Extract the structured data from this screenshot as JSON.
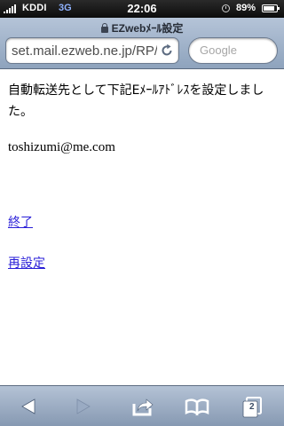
{
  "status_bar": {
    "carrier": "KDDI",
    "network": "3G",
    "time": "22:06",
    "battery_percent": "89%",
    "battery_level": 0.89,
    "signal_bars": 5
  },
  "browser": {
    "page_title": "EZwebﾒｰﾙ設定",
    "address": "set.mail.ezweb.ne.jp/RP/",
    "search_placeholder": "Google",
    "open_pages": "2"
  },
  "page": {
    "message": "自動転送先として下記Eﾒｰﾙｱﾄﾞﾚｽを設定しました。",
    "email": "toshizumi@me.com",
    "links": {
      "end": "終了",
      "reset": "再設定"
    }
  },
  "icons": {
    "status": [
      "signal-icon",
      "lock-rotation-icon",
      "battery-icon"
    ],
    "header": [
      "secure-lock-icon",
      "reload-icon"
    ],
    "toolbar": [
      "back-icon",
      "forward-icon",
      "share-icon",
      "bookmarks-icon",
      "pages-icon"
    ]
  },
  "colors": {
    "link": "#2a1fd8",
    "toolbar": "#8fa3bc",
    "status_bar": "#111111"
  }
}
